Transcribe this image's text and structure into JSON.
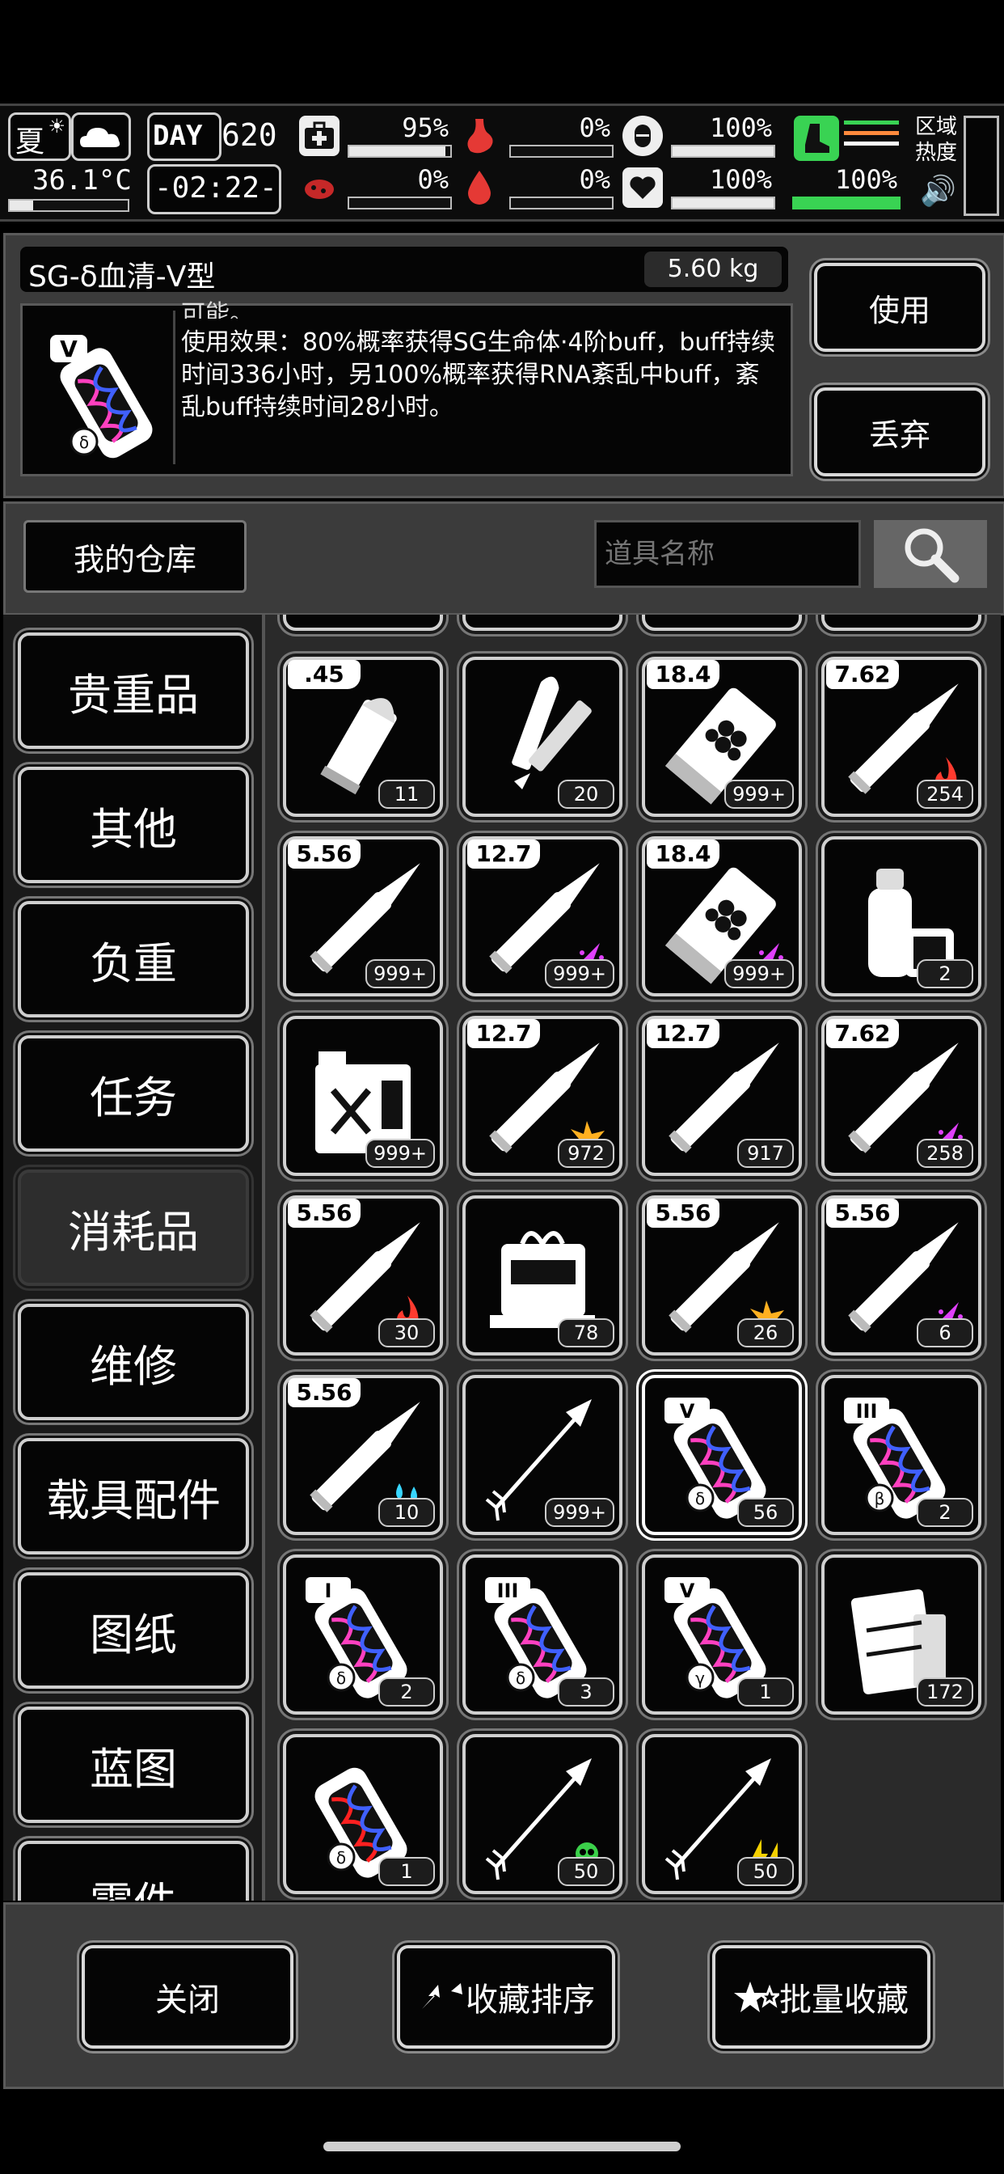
{
  "status": {
    "season": "夏",
    "temperature": "36.1°C",
    "day_label": "DAY",
    "day_value": "620",
    "time": "-02:22-",
    "stats": [
      {
        "name": "health",
        "value": "95%",
        "fill": 0.95
      },
      {
        "name": "hunger",
        "value": "0%",
        "fill": 0
      },
      {
        "name": "stamina",
        "value": "100%",
        "fill": 1
      },
      {
        "name": "infection",
        "value": "0%",
        "fill": 0
      },
      {
        "name": "thirst",
        "value": "0%",
        "fill": 0
      },
      {
        "name": "mood",
        "value": "100%",
        "fill": 1
      },
      {
        "name": "weight",
        "value": "100%",
        "fill": 1
      }
    ],
    "region_heat": [
      "区域",
      "热度"
    ]
  },
  "item": {
    "name": "SG-δ血清-V型",
    "weight": "5.60 kg",
    "description_partial": "可能。",
    "description": "使用效果：80%概率获得SG生命体·4阶buff，buff持续时间336小时，另100%概率获得RNA紊乱中buff，紊乱buff持续时间28小时。",
    "icon_badge": "V",
    "use_label": "使用",
    "discard_label": "丢弃"
  },
  "warehouse": {
    "tab_label": "我的仓库",
    "search_placeholder": "道具名称"
  },
  "categories": [
    "贵重品",
    "其他",
    "负重",
    "任务",
    "消耗品",
    "维修",
    "载具配件",
    "图纸",
    "蓝图",
    "零件"
  ],
  "active_category": "消耗品",
  "items": [
    {
      "kind": "bullet",
      "caliber": ".45",
      "qty": "11"
    },
    {
      "kind": "flare",
      "caliber": "",
      "qty": "20"
    },
    {
      "kind": "shell",
      "caliber": "18.4",
      "qty": "999+"
    },
    {
      "kind": "rifle",
      "caliber": "7.62",
      "qty": "254",
      "mark": "fire"
    },
    {
      "kind": "rifle",
      "caliber": "5.56",
      "qty": "999+"
    },
    {
      "kind": "rifle",
      "caliber": "12.7",
      "qty": "999+",
      "mark": "pierce"
    },
    {
      "kind": "shell",
      "caliber": "18.4",
      "qty": "999+",
      "mark": "pierce"
    },
    {
      "kind": "spray",
      "caliber": "",
      "qty": "2"
    },
    {
      "kind": "jerrycan",
      "caliber": "",
      "qty": "999+"
    },
    {
      "kind": "rifle",
      "caliber": "12.7",
      "qty": "972",
      "mark": "explode"
    },
    {
      "kind": "rifle",
      "caliber": "12.7",
      "qty": "917"
    },
    {
      "kind": "rifle",
      "caliber": "7.62",
      "qty": "258",
      "mark": "pierce"
    },
    {
      "kind": "rifle",
      "caliber": "5.56",
      "qty": "30",
      "mark": "fire"
    },
    {
      "kind": "machine",
      "caliber": "",
      "qty": "78"
    },
    {
      "kind": "rifle",
      "caliber": "5.56",
      "qty": "26",
      "mark": "explode"
    },
    {
      "kind": "rifle",
      "caliber": "5.56",
      "qty": "6",
      "mark": "pierce"
    },
    {
      "kind": "rifle",
      "caliber": "5.56",
      "qty": "10",
      "mark": "water"
    },
    {
      "kind": "arrow",
      "caliber": "",
      "qty": "999+"
    },
    {
      "kind": "serum",
      "caliber": "",
      "qty": "56",
      "badge": "V",
      "greek": "δ",
      "selected": true
    },
    {
      "kind": "serum",
      "caliber": "",
      "qty": "2",
      "badge": "III",
      "greek": "β"
    },
    {
      "kind": "serum",
      "caliber": "",
      "qty": "2",
      "badge": "I",
      "greek": "δ"
    },
    {
      "kind": "serum",
      "caliber": "",
      "qty": "3",
      "badge": "III",
      "greek": "δ"
    },
    {
      "kind": "serum",
      "caliber": "",
      "qty": "1",
      "badge": "V",
      "greek": "γ"
    },
    {
      "kind": "fuelpack",
      "caliber": "",
      "qty": "172"
    },
    {
      "kind": "serum-red",
      "caliber": "",
      "qty": "1",
      "badge": "",
      "greek": "δ"
    },
    {
      "kind": "arrow",
      "caliber": "",
      "qty": "50",
      "mark": "poison"
    },
    {
      "kind": "arrow",
      "caliber": "",
      "qty": "50",
      "mark": "shock"
    }
  ],
  "bottom": {
    "close_label": "关闭",
    "sort_label": "收藏排序",
    "batch_label": "批量收藏"
  },
  "colors": {
    "fire": "#ff3b2f",
    "pierce": "#e040fb",
    "explode": "#ffb020",
    "water": "#38d6ff",
    "poison": "#3bd14a",
    "shock": "#f5d000",
    "serum_pink": "#ff40c0",
    "serum_blue": "#4060ff",
    "serum_red": "#ff2020",
    "accent_green": "#39d353"
  }
}
